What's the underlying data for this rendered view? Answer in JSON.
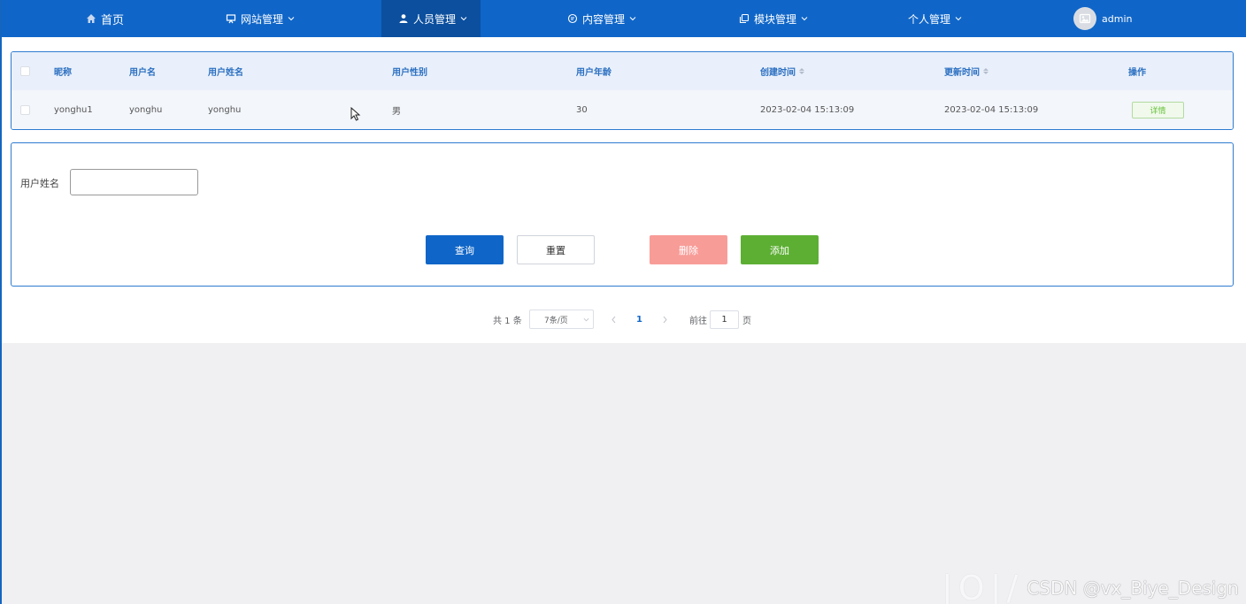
{
  "nav": {
    "items": [
      {
        "label": "首页",
        "icon": "home-icon",
        "has_dropdown": false
      },
      {
        "label": "网站管理",
        "icon": "monitor-icon",
        "has_dropdown": true
      },
      {
        "label": "人员管理",
        "icon": "user-icon",
        "has_dropdown": true,
        "active": true
      },
      {
        "label": "内容管理",
        "icon": "chat-icon",
        "has_dropdown": true
      },
      {
        "label": "模块管理",
        "icon": "copy-icon",
        "has_dropdown": true
      },
      {
        "label": "个人管理",
        "icon": "",
        "has_dropdown": true
      }
    ],
    "user": {
      "name": "admin",
      "avatar_icon": "image-placeholder-icon"
    }
  },
  "table": {
    "columns": [
      "昵称",
      "用户名",
      "用户姓名",
      "用户性别",
      "用户年龄",
      "创建时间",
      "更新时间",
      "操作"
    ],
    "rows": [
      {
        "nickname": "yonghu1",
        "username": "yonghu",
        "realname": "yonghu",
        "gender": "男",
        "age": "30",
        "created": "2023-02-04 15:13:09",
        "updated": "2023-02-04 15:13:09",
        "action": "详情"
      }
    ]
  },
  "search": {
    "label": "用户姓名",
    "value": "",
    "buttons": {
      "query": "查询",
      "reset": "重置",
      "delete": "删除",
      "add": "添加"
    }
  },
  "pagination": {
    "total": "共 1 条",
    "page_size": "7条/页",
    "current_page": "1",
    "goto_prefix": "前往",
    "goto_value": "1",
    "goto_suffix": "页"
  },
  "watermark": {
    "text": "CSDN @vx_Biye_Design"
  },
  "colors": {
    "nav": "#1066c8",
    "nav_active": "#0b4f9e",
    "query": "#1066c8",
    "delete": "#f89c98",
    "add": "#5daf34"
  }
}
